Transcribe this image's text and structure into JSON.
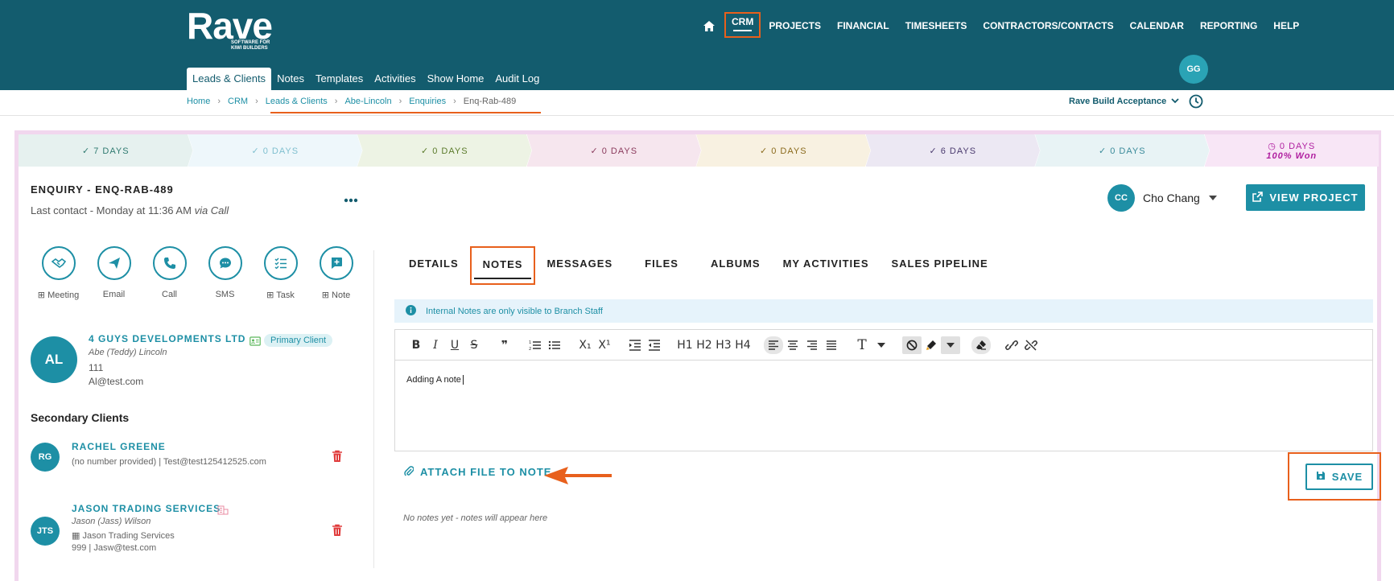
{
  "brand": {
    "name": "Rave",
    "tagline": "SOFTWARE FOR KIWI BUILDERS"
  },
  "main_nav": [
    "CRM",
    "PROJECTS",
    "FINANCIAL",
    "TIMESHEETS",
    "CONTRACTORS/CONTACTS",
    "CALENDAR",
    "REPORTING",
    "HELP"
  ],
  "sub_nav": [
    "Leads & Clients",
    "Notes",
    "Templates",
    "Activities",
    "Show Home",
    "Audit Log"
  ],
  "user_initials": "GG",
  "breadcrumb": [
    "Home",
    "CRM",
    "Leads & Clients",
    "Abe-Lincoln",
    "Enquiries",
    "Enq-Rab-489"
  ],
  "acceptance_label": "Rave Build Acceptance",
  "stages": [
    {
      "label": "7 DAYS",
      "color": "#2f7a70",
      "bg": "#e6f1ef"
    },
    {
      "label": "0 DAYS",
      "color": "#7fbfcf",
      "bg": "#eef7fb"
    },
    {
      "label": "0 DAYS",
      "color": "#5a7a2a",
      "bg": "#edf3e4"
    },
    {
      "label": "0 DAYS",
      "color": "#8a3a5c",
      "bg": "#f6e6ee"
    },
    {
      "label": "0 DAYS",
      "color": "#8a6a1c",
      "bg": "#f8f1e1"
    },
    {
      "label": "6 DAYS",
      "color": "#4a3a6e",
      "bg": "#ece8f3"
    },
    {
      "label": "0 DAYS",
      "color": "#3a8a9a",
      "bg": "#e8f3f5"
    },
    {
      "label": "0 DAYS",
      "sub": "100% Won",
      "color": "#b020a0",
      "bg": "#f8e6f6"
    }
  ],
  "enquiry": {
    "title": "ENQUIRY - ENQ-RAB-489",
    "last_contact": "Last contact - Monday at 11:36 AM",
    "last_contact_via": "via Call"
  },
  "owner": {
    "initials": "CC",
    "name": "Cho Chang"
  },
  "view_project_label": "VIEW PROJECT",
  "actions": [
    "Meeting",
    "Email",
    "Call",
    "SMS",
    "Task",
    "Note"
  ],
  "primary_client": {
    "initials": "AL",
    "company": "4 GUYS DEVELOPMENTS LTD",
    "badge": "Primary Client",
    "contact": "Abe (Teddy) Lincoln",
    "phone": "111",
    "email": "Al@test.com"
  },
  "secondary_title": "Secondary Clients",
  "secondary_clients": [
    {
      "initials": "RG",
      "name": "RACHEL GREENE",
      "line1": "(no number provided)   |   Test@test125412525.com"
    },
    {
      "initials": "JTS",
      "name": "JASON TRADING SERVICES",
      "contact": "Jason (Jass) Wilson",
      "company": "Jason Trading Services",
      "line2": "999   |   Jasw@test.com"
    }
  ],
  "tabs": [
    "DETAILS",
    "NOTES",
    "MESSAGES",
    "FILES",
    "ALBUMS",
    "MY ACTIVITIES",
    "SALES PIPELINE"
  ],
  "info_text": "Internal Notes are only visible to Branch Staff",
  "toolbar": {
    "bold": "B",
    "italic": "I",
    "underline": "U",
    "strike": "S",
    "quote": "❞",
    "ol": "⒈",
    "ul": "☰",
    "sub": "X₁",
    "sup": "X¹",
    "h1": "H1",
    "h2": "H2",
    "h3": "H3",
    "h4": "H4",
    "font": "T"
  },
  "editor_text": "Adding A note",
  "attach_label": "ATTACH FILE TO NOTE",
  "save_label": "SAVE",
  "empty_notes": "No notes yet - notes will appear here",
  "colors": {
    "primary": "#135c6e",
    "accent": "#1d8fa5",
    "annotation": "#e8601c"
  }
}
